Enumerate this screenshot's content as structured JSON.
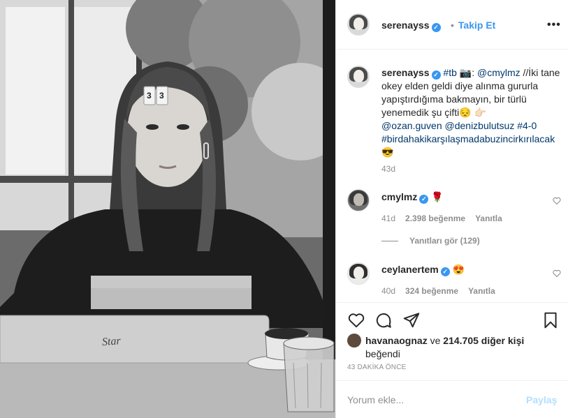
{
  "post": {
    "username": "serenayss",
    "follow_label": "Takip Et",
    "separator": "•",
    "more": "•••"
  },
  "caption": {
    "username": "serenayss",
    "hashtag_tb": "#tb",
    "camera_emoji": "📷",
    "colon": ":",
    "mention1": "@cmylmz",
    "text1": " //İki tane okey elden geldi diye alınma gururla yapıştırdığıma bakmayın, bir türlü yenemedik şu çifti",
    "emoji1": "😔",
    "emoji2": "👉🏻",
    "mention2": "@ozan.guven",
    "mention3": "@denizbulutsuz",
    "score_tag": "#4-0",
    "hashtag_long": "#birdahakikarşılaşmadabuzincirkırılacak",
    "emoji3": "😎",
    "time": "43d"
  },
  "comments": [
    {
      "username": "cmylmz",
      "text": "🌹",
      "time": "41d",
      "likes": "2.398 beğenme",
      "reply": "Yanıtla"
    },
    {
      "username": "ceylanertem",
      "text": "😍",
      "time": "40d",
      "likes": "324 beğenme",
      "reply": "Yanıtla"
    }
  ],
  "view_replies": "Yanıtları gör (129)",
  "likes": {
    "user": "havanaognaz",
    "text": " ve ",
    "others": "214.705 diğer kişi",
    "suffix": "beğendi"
  },
  "post_time": "43 DAKİKA ÖNCE",
  "add_comment": {
    "placeholder": "Yorum ekle...",
    "post_label": "Paylaş"
  },
  "photo": {
    "tile_left": "3",
    "tile_right": "3",
    "laptop_text": "Star"
  },
  "colors": {
    "accent": "#3897f0",
    "muted": "#8e8e8e",
    "text": "#262626"
  }
}
